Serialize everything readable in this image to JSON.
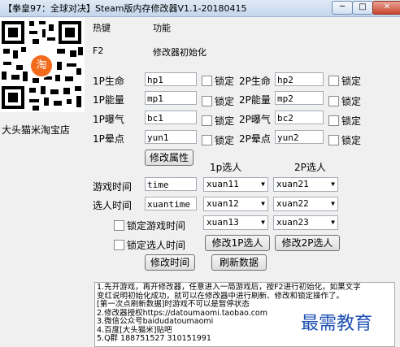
{
  "window": {
    "title": "【拳皇97：全球对决】Steam版内存修改器V1.1-20180415",
    "min_label": "─",
    "max_label": "□",
    "close_label": "✕"
  },
  "promo": {
    "logo_char": "淘",
    "shop_name": "大头猫米淘宝店"
  },
  "header": {
    "hotkey": "热键",
    "function": "功能"
  },
  "hotkey_row": {
    "key": "F2",
    "desc": "修改器初始化"
  },
  "fields": [
    {
      "p1_label": "1P生命",
      "p1_value": "hp1",
      "p2_label": "2P生命",
      "p2_value": "hp2",
      "lock": "锁定"
    },
    {
      "p1_label": "1P能量",
      "p1_value": "mp1",
      "p2_label": "2P能量",
      "p2_value": "mp2",
      "lock": "锁定"
    },
    {
      "p1_label": "1P曝气",
      "p1_value": "bc1",
      "p2_label": "2P曝气",
      "p2_value": "bc2",
      "lock": "锁定"
    },
    {
      "p1_label": "1P晕点",
      "p1_value": "yun1",
      "p2_label": "2P晕点",
      "p2_value": "yun2",
      "lock": "锁定"
    }
  ],
  "modify_button": "修改属性",
  "p1_select_label": "1p选人",
  "p2_select_label": "2P选人",
  "game_time": {
    "label": "游戏时间",
    "value": "time"
  },
  "select_time": {
    "label": "选人时间",
    "value": "xuantime"
  },
  "p1_chars": [
    "xuan11",
    "xuan12",
    "xuan13"
  ],
  "p2_chars": [
    "xuan21",
    "xuan22",
    "xuan23"
  ],
  "lock_game_time": "锁定游戏时间",
  "lock_select_time": "锁定选人时间",
  "modify_1p": "修改1P选人",
  "modify_2p": "修改2P选人",
  "modify_time": "修改时间",
  "refresh": "刷新数据",
  "notes": [
    "1.先开游戏，再开修改器，任意进入一局游戏后，按F2进行初始化，如果文字",
    "变红说明初始化成功，就可以在修改器中进行刷新、修改和锁定操作了。",
    "[第一次点刷新数据]时游戏不可以是暂停状态",
    "2.修改器授权https://datoumaomi.taobao.com",
    "3.微信公众号baidudatoumaomi",
    "4.百度[大头猫米]贴吧",
    "5.Q群 188751527 310151991"
  ],
  "watermark": "最需教育"
}
